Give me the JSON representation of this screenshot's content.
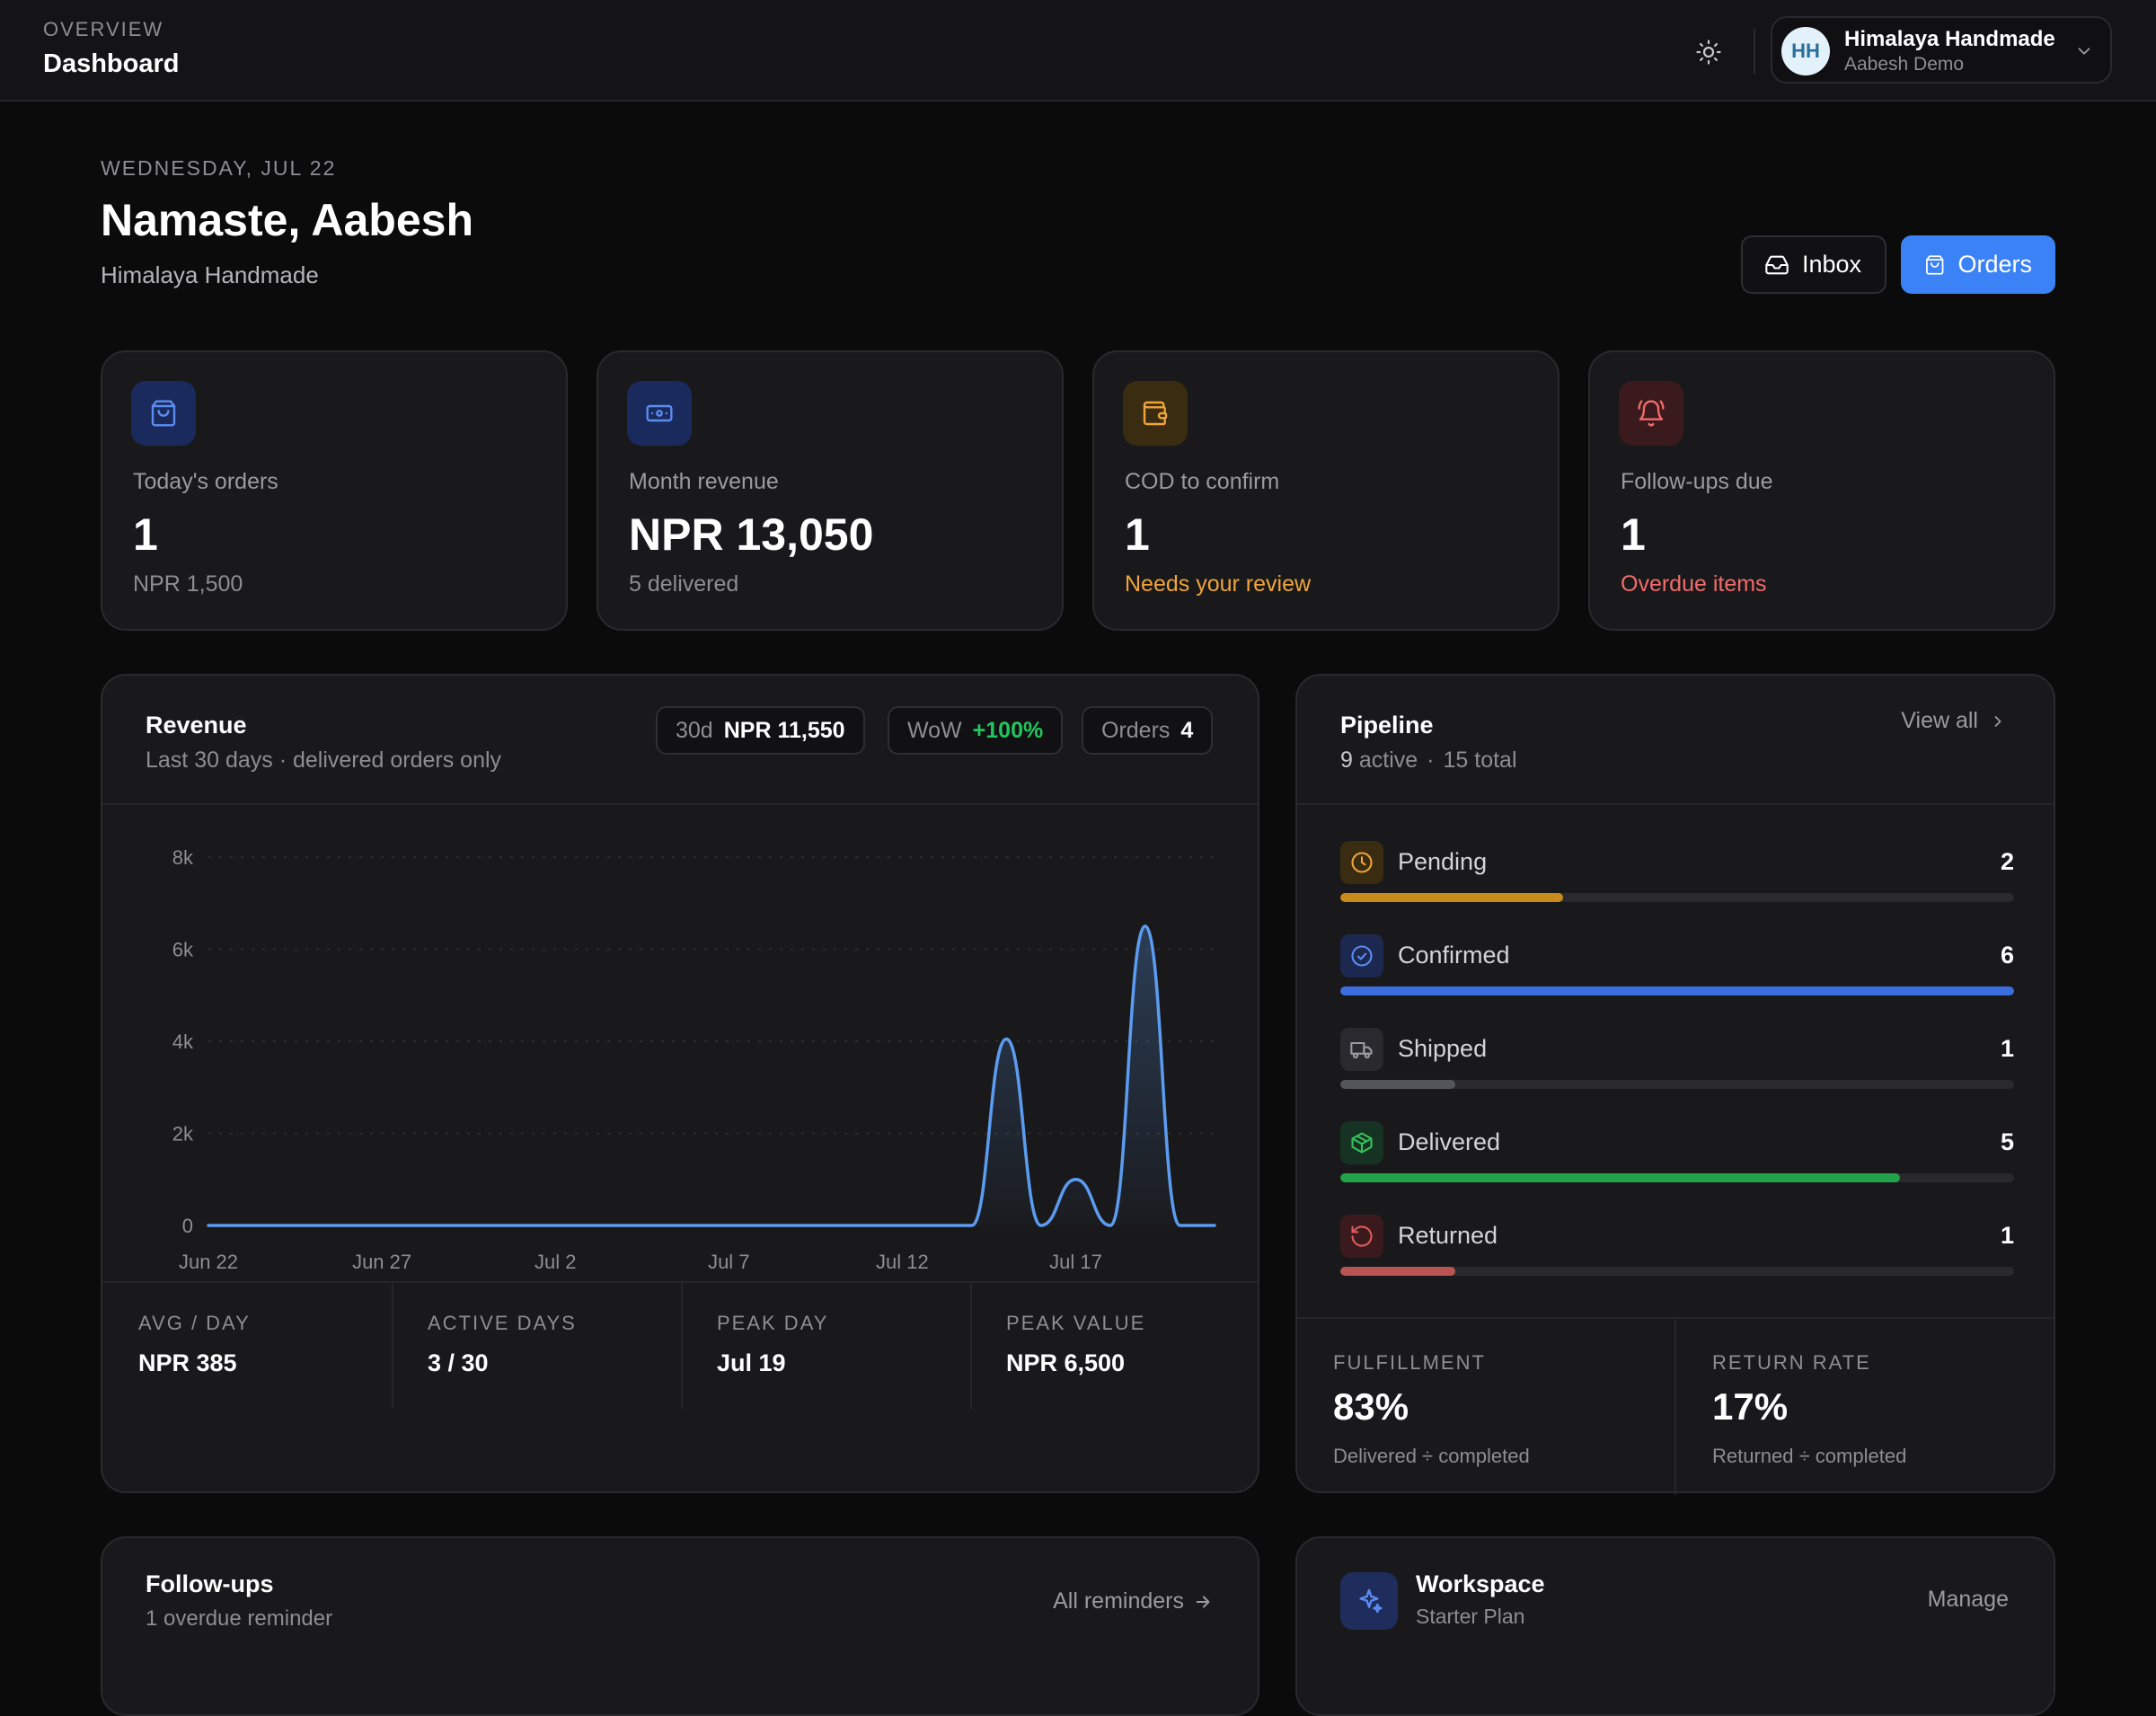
{
  "header": {
    "section": "OVERVIEW",
    "title": "Dashboard",
    "account": {
      "initials": "HH",
      "name": "Himalaya Handmade",
      "sub": "Aabesh Demo"
    }
  },
  "page": {
    "date": "WEDNESDAY, JUL 22",
    "greeting": "Namaste, Aabesh",
    "store": "Himalaya Handmade",
    "inbox_label": "Inbox",
    "orders_label": "Orders"
  },
  "kpis": [
    {
      "label": "Today's orders",
      "value": "1",
      "sub": "NPR 1,500",
      "icon": "shopping-bag-icon",
      "tone": "blue"
    },
    {
      "label": "Month revenue",
      "value": "NPR 13,050",
      "sub": "5 delivered",
      "icon": "banknote-icon",
      "tone": "blue"
    },
    {
      "label": "COD to confirm",
      "value": "1",
      "sub": "Needs your review",
      "icon": "wallet-icon",
      "tone": "amber"
    },
    {
      "label": "Follow-ups due",
      "value": "1",
      "sub": "Overdue items",
      "icon": "bell-icon",
      "tone": "red"
    }
  ],
  "revenue": {
    "title": "Revenue",
    "subtitle": "Last 30 days · delivered orders only",
    "pills": {
      "range_label": "30d",
      "range_value": "NPR 11,550",
      "wow_label": "WoW",
      "wow_value": "+100%",
      "orders_label": "Orders",
      "orders_value": "4"
    },
    "stats": [
      {
        "label": "AVG / DAY",
        "value": "NPR 385"
      },
      {
        "label": "ACTIVE DAYS",
        "value": "3 / 30"
      },
      {
        "label": "PEAK DAY",
        "value": "Jul 19"
      },
      {
        "label": "PEAK VALUE",
        "value": "NPR 6,500"
      }
    ]
  },
  "chart_data": {
    "type": "area",
    "x_ticks": [
      "Jun 22",
      "Jun 27",
      "Jul 2",
      "Jul 7",
      "Jul 12",
      "Jul 17"
    ],
    "y_ticks": [
      "0",
      "2k",
      "4k",
      "6k",
      "8k"
    ],
    "ylim": [
      0,
      8000
    ],
    "grid": true,
    "series": [
      {
        "color": "#5b9cf0",
        "x": [
          "Jun 22",
          "Jun 23",
          "Jun 24",
          "Jun 25",
          "Jun 26",
          "Jun 27",
          "Jun 28",
          "Jun 29",
          "Jun 30",
          "Jul 1",
          "Jul 2",
          "Jul 3",
          "Jul 4",
          "Jul 5",
          "Jul 6",
          "Jul 7",
          "Jul 8",
          "Jul 9",
          "Jul 10",
          "Jul 11",
          "Jul 12",
          "Jul 13",
          "Jul 14",
          "Jul 15",
          "Jul 16",
          "Jul 17",
          "Jul 18",
          "Jul 19",
          "Jul 20",
          "Jul 21"
        ],
        "values": [
          0,
          0,
          0,
          0,
          0,
          0,
          0,
          0,
          0,
          0,
          0,
          0,
          0,
          0,
          0,
          0,
          0,
          0,
          0,
          0,
          0,
          0,
          0,
          4050,
          0,
          1000,
          0,
          6500,
          0,
          0
        ]
      }
    ]
  },
  "pipeline": {
    "title": "Pipeline",
    "active_count": "9",
    "active_label": "active",
    "separator": "·",
    "total_label": "15 total",
    "view_all": "View all",
    "stages": [
      {
        "name": "Pending",
        "count": "2",
        "fraction": 0.33,
        "color": "#c98a1c",
        "icon": "clock-icon",
        "icon_color": "#f0a43a",
        "icon_bg": "#3a2c10"
      },
      {
        "name": "Confirmed",
        "count": "6",
        "fraction": 1.0,
        "color": "#3b6fe0",
        "icon": "check-circle-icon",
        "icon_color": "#5b8cf0",
        "icon_bg": "#1c2850"
      },
      {
        "name": "Shipped",
        "count": "1",
        "fraction": 0.17,
        "color": "#55555c",
        "icon": "truck-icon",
        "icon_color": "#9a9aa0",
        "icon_bg": "#2a2a2e"
      },
      {
        "name": "Delivered",
        "count": "5",
        "fraction": 0.83,
        "color": "#22a34a",
        "icon": "package-icon",
        "icon_color": "#34c05a",
        "icon_bg": "#163222"
      },
      {
        "name": "Returned",
        "count": "1",
        "fraction": 0.17,
        "color": "#b85454",
        "icon": "rotate-ccw-icon",
        "icon_color": "#e05a5a",
        "icon_bg": "#3a1a1c"
      }
    ],
    "footer": [
      {
        "label": "FULFILLMENT",
        "value": "83%",
        "desc": "Delivered ÷ completed"
      },
      {
        "label": "RETURN RATE",
        "value": "17%",
        "desc": "Returned ÷ completed"
      }
    ]
  },
  "followups": {
    "title": "Follow-ups",
    "subtitle": "1 overdue reminder",
    "link": "All reminders"
  },
  "workspace": {
    "title": "Workspace",
    "subtitle": "Starter Plan",
    "link": "Manage",
    "icon": "sparkles-icon"
  }
}
